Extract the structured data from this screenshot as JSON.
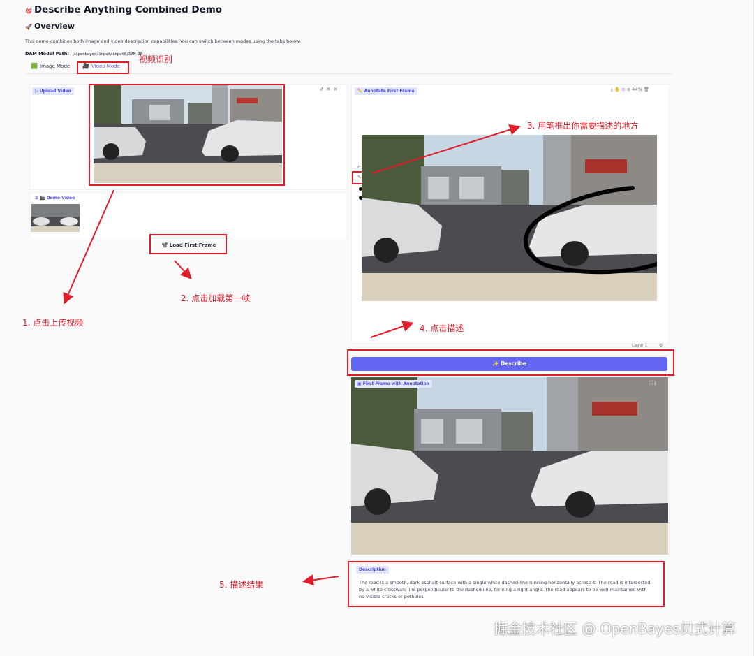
{
  "page": {
    "title": "Describe Anything Combined Demo",
    "overview_heading": "Overview",
    "intro": "This demo combines both image and video description capabilities. You can switch between modes using the tabs below.",
    "model_path_label": "DAM Model Path:",
    "model_path_value": "/openbayes/input/input0/DAM-3B"
  },
  "tabs": [
    {
      "label": "Image Mode",
      "icon": "image-icon"
    },
    {
      "label": "Video Mode",
      "icon": "film-icon"
    }
  ],
  "left": {
    "upload_label": "Upload Video",
    "demo_label": "Demo Video",
    "load_button": "Load First Frame"
  },
  "right": {
    "annotate_label": "Annotate First Frame",
    "zoom": "44%",
    "layer_label": "Layer 1",
    "describe_button": "Describe",
    "result_label": "First Frame with Annotation",
    "description_label": "Description",
    "description_text": "The road is a smooth, dark asphalt surface with a single white dashed line running horizontally across it. The road is intersected by a white crosswalk line perpendicular to the dashed line, forming a right angle. The road appears to be well-maintained with no visible cracks or potholes."
  },
  "annotations": {
    "video_recognition": "视频识别",
    "step1": "1. 点击上传视频",
    "step2": "2. 点击加载第一帧",
    "step3": "3. 用笔框出你需要描述的地方",
    "step4": "4. 点击描述",
    "step5": "5. 描述结果"
  },
  "watermark": "掘金技术社区 @ OpenBayes贝式计算",
  "colors": {
    "accent": "#6366f1",
    "annotation_red": "#e11d2a"
  }
}
